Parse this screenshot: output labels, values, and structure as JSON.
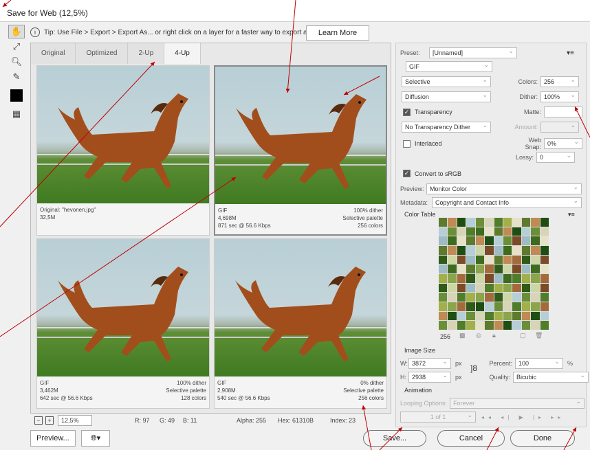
{
  "window": {
    "title": "Save for Web (12,5%)"
  },
  "tip": {
    "text": "Tip: Use File > Export > Export As...  or right click on a layer for a faster way to export assets",
    "learn_more": "Learn More"
  },
  "tabs": [
    "Original",
    "Optimized",
    "2-Up",
    "4-Up"
  ],
  "active_tab": "4-Up",
  "previews": [
    {
      "left_lines": [
        "Original: \"hevonen.jpg\"",
        "32,5M",
        ""
      ],
      "right_lines": [
        "",
        "",
        ""
      ]
    },
    {
      "left_lines": [
        "GIF",
        "4,698M",
        "871 sec @ 56.6 Kbps"
      ],
      "right_lines": [
        "100% dither",
        "Selective palette",
        "256 colors"
      ]
    },
    {
      "left_lines": [
        "GIF",
        "3,462M",
        "642 sec @ 56.6 Kbps"
      ],
      "right_lines": [
        "100% dither",
        "Selective palette",
        "128 colors"
      ]
    },
    {
      "left_lines": [
        "GIF",
        "2,908M",
        "540 sec @ 56.6 Kbps"
      ],
      "right_lines": [
        "0% dither",
        "Selective palette",
        "256 colors"
      ]
    }
  ],
  "status": {
    "zoom": "12,5%",
    "r": "R: 97",
    "g": "G: 49",
    "b": "B: 11",
    "alpha": "Alpha: 255",
    "hex": "Hex: 61310B",
    "index": "Index: 23"
  },
  "settings": {
    "preset_label": "Preset:",
    "preset_value": "[Unnamed]",
    "format": "GIF",
    "reduction": "Selective",
    "dither_algo": "Diffusion",
    "colors_label": "Colors:",
    "colors_value": "256",
    "dither_label": "Dither:",
    "dither_value": "100%",
    "transparency_label": "Transparency",
    "transparency_checked": true,
    "matte_label": "Matte:",
    "trans_dither": "No Transparency Dither",
    "amount_label": "Amount:",
    "interlaced_label": "Interlaced",
    "interlaced_checked": false,
    "websnap_label": "Web Snap:",
    "websnap_value": "0%",
    "lossy_label": "Lossy:",
    "lossy_value": "0",
    "srgb_label": "Convert to sRGB",
    "srgb_checked": true,
    "preview_label": "Preview:",
    "preview_value": "Monitor Color",
    "metadata_label": "Metadata:",
    "metadata_value": "Copyright and Contact Info"
  },
  "color_table": {
    "title": "Color Table",
    "count": "256"
  },
  "image_size": {
    "title": "Image Size",
    "w_label": "W:",
    "w_value": "3872",
    "h_label": "H:",
    "h_value": "2938",
    "unit": "px",
    "percent_label": "Percent:",
    "percent_value": "100",
    "percent_unit": "%",
    "quality_label": "Quality:",
    "quality_value": "Bicubic"
  },
  "animation": {
    "title": "Animation",
    "looping_label": "Looping Options:",
    "looping_value": "Forever",
    "frame": "1 of 1"
  },
  "buttons": {
    "preview": "Preview...",
    "save": "Save...",
    "cancel": "Cancel",
    "done": "Done"
  },
  "colors": {
    "annotation": "#c00000"
  }
}
